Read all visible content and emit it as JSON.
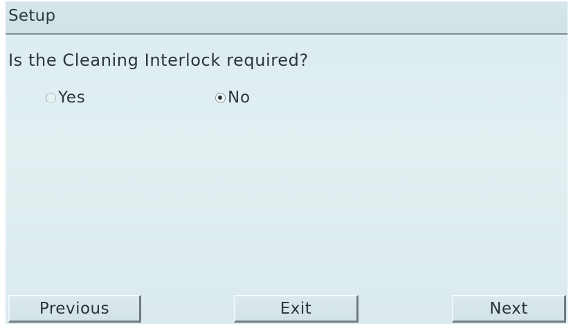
{
  "header": {
    "title": "Setup"
  },
  "main": {
    "question": "Is the Cleaning Interlock required?",
    "options": [
      {
        "label": "Yes",
        "selected": false
      },
      {
        "label": "No",
        "selected": true
      }
    ]
  },
  "footer": {
    "previous_label": "Previous",
    "exit_label": "Exit",
    "next_label": "Next"
  },
  "colors": {
    "screen_background": "#dfeef0",
    "text": "#2d3638",
    "divider": "#7f8c8e"
  }
}
